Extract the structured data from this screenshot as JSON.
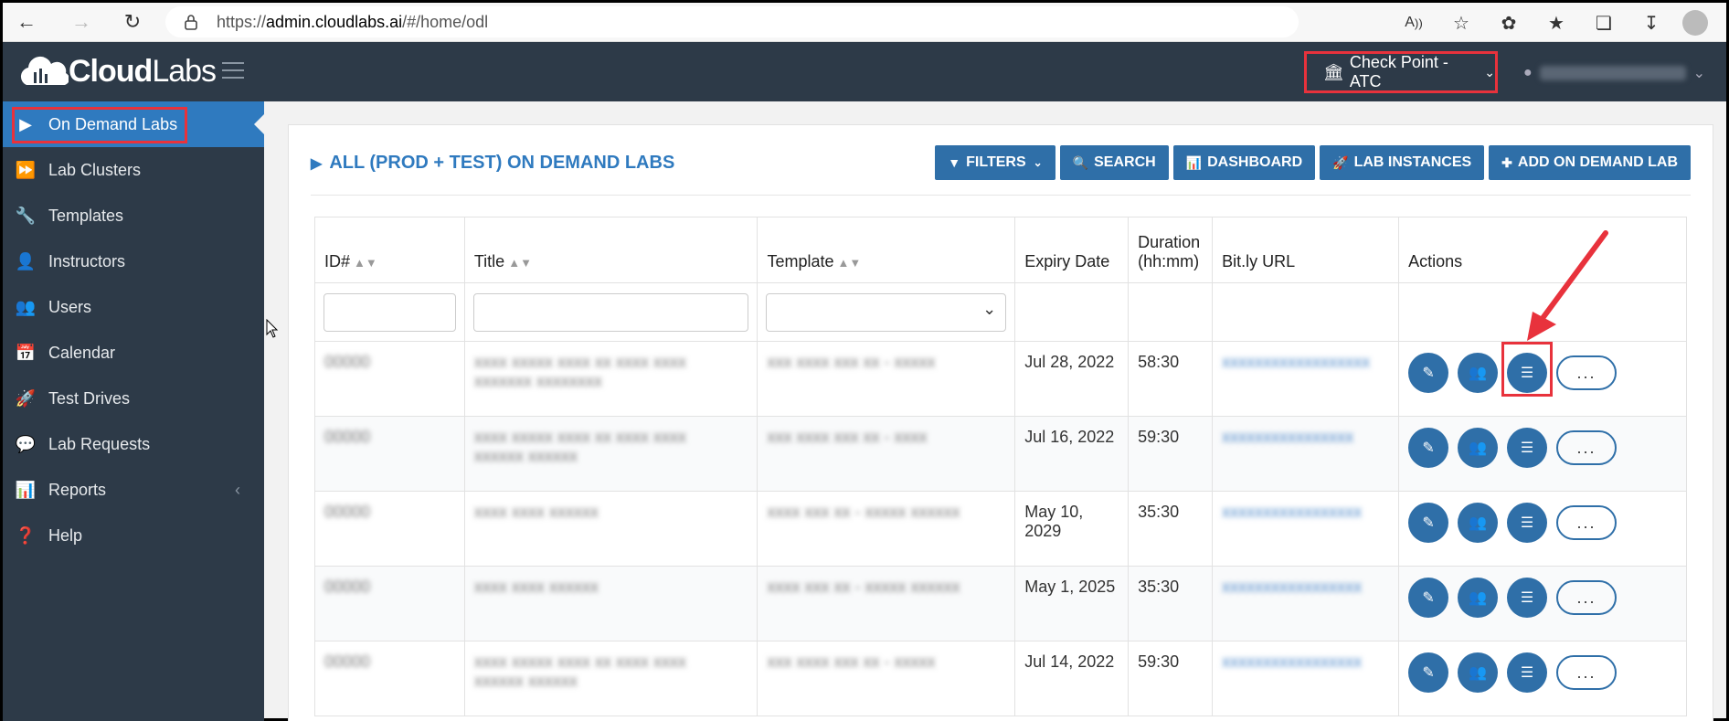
{
  "browser": {
    "url_prefix": "https://",
    "url_host": "admin.cloudlabs.ai",
    "url_path": "/#/home/odl"
  },
  "header": {
    "logo_cloud": "Cloud",
    "logo_labs": "Labs",
    "org_name": "Check Point - ATC"
  },
  "sidebar": {
    "items": [
      {
        "label": "On Demand Labs",
        "icon": "play-icon"
      },
      {
        "label": "Lab Clusters",
        "icon": "fast-forward-icon"
      },
      {
        "label": "Templates",
        "icon": "wrench-icon"
      },
      {
        "label": "Instructors",
        "icon": "user-icon"
      },
      {
        "label": "Users",
        "icon": "users-icon"
      },
      {
        "label": "Calendar",
        "icon": "calendar-icon"
      },
      {
        "label": "Test Drives",
        "icon": "rocket-icon"
      },
      {
        "label": "Lab Requests",
        "icon": "comments-icon"
      },
      {
        "label": "Reports",
        "icon": "bar-chart-icon"
      },
      {
        "label": "Help",
        "icon": "question-icon"
      }
    ]
  },
  "main": {
    "title": "ALL (PROD + TEST) ON DEMAND LABS",
    "toolbar": {
      "filters": "FILTERS",
      "search": "SEARCH",
      "dashboard": "DASHBOARD",
      "lab_instances": "LAB INSTANCES",
      "add": "ADD ON DEMAND LAB"
    },
    "columns": {
      "id": "ID#",
      "title": "Title",
      "template": "Template",
      "expiry": "Expiry Date",
      "duration_line1": "Duration",
      "duration_line2": "(hh:mm)",
      "bitly": "Bit.ly URL",
      "actions": "Actions"
    },
    "rows": [
      {
        "expiry": "Jul 28, 2022",
        "duration": "58:30"
      },
      {
        "expiry": "Jul 16, 2022",
        "duration": "59:30"
      },
      {
        "expiry": "May 10, 2029",
        "duration": "35:30"
      },
      {
        "expiry": "May 1, 2025",
        "duration": "35:30"
      },
      {
        "expiry": "Jul 14, 2022",
        "duration": "59:30"
      }
    ],
    "more_label": "..."
  },
  "colors": {
    "sidebar_bg": "#2d3a48",
    "active_blue": "#2f7abf",
    "button_blue": "#2f6fa8",
    "highlight_red": "#e8323c"
  }
}
